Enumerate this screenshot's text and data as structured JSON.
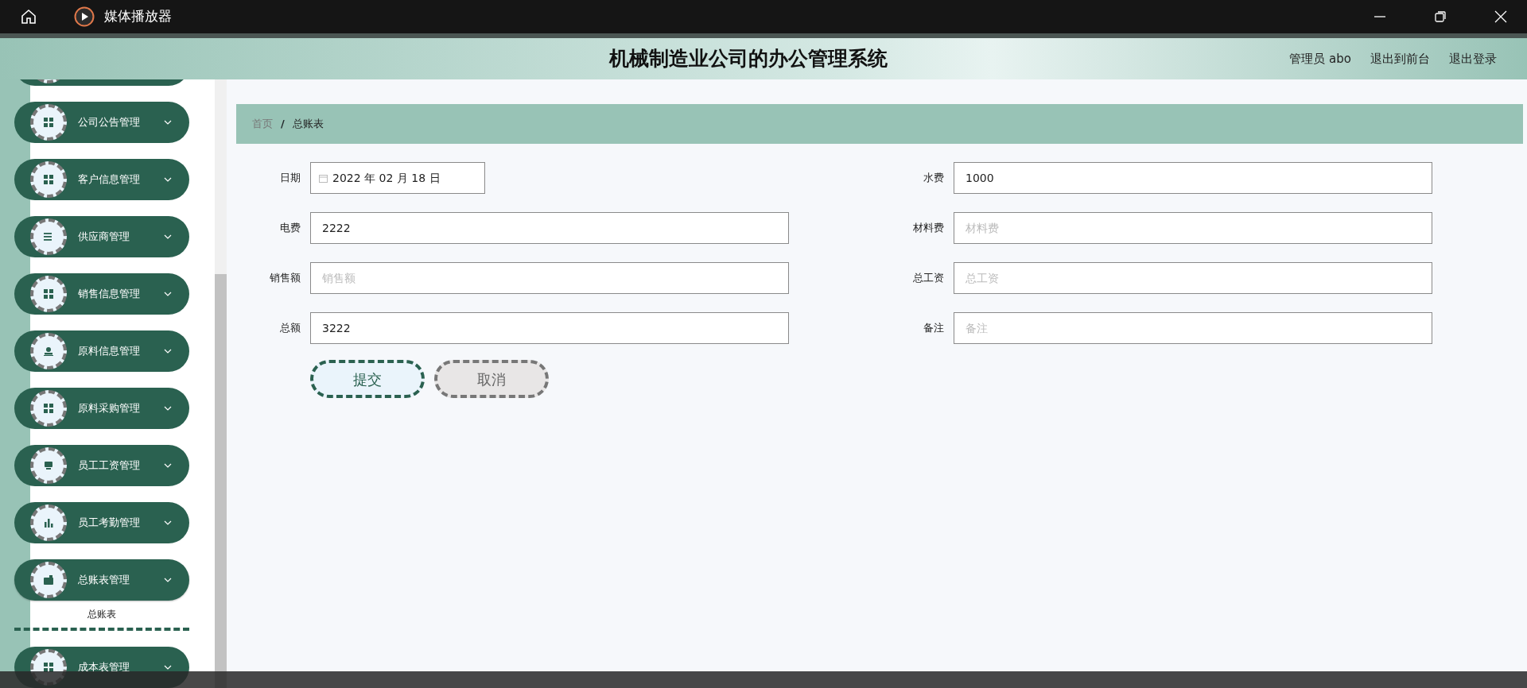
{
  "window": {
    "title": "媒体播放器"
  },
  "header": {
    "title": "机械制造业公司的办公管理系统",
    "links": [
      "管理员 abo",
      "退出到前台",
      "退出登录"
    ]
  },
  "sidebar": {
    "items": [
      {
        "label": "公司公告管理",
        "expanded": false
      },
      {
        "label": "客户信息管理",
        "expanded": false
      },
      {
        "label": "供应商管理",
        "expanded": false
      },
      {
        "label": "销售信息管理",
        "expanded": false
      },
      {
        "label": "原料信息管理",
        "expanded": false
      },
      {
        "label": "原料采购管理",
        "expanded": false
      },
      {
        "label": "员工工资管理",
        "expanded": false
      },
      {
        "label": "员工考勤管理",
        "expanded": false
      },
      {
        "label": "总账表管理",
        "expanded": true,
        "children": [
          {
            "label": "总账表"
          }
        ]
      },
      {
        "label": "成本表管理",
        "expanded": false
      }
    ]
  },
  "breadcrumb": {
    "items": [
      "首页",
      "总账表"
    ],
    "separator": "/"
  },
  "form": {
    "fields": [
      {
        "label": "日期",
        "kind": "date",
        "value": "2022 年 02 月 18 日"
      },
      {
        "label": "水费",
        "kind": "text",
        "value": "1000"
      },
      {
        "label": "电费",
        "kind": "text",
        "value": "2222"
      },
      {
        "label": "材料费",
        "kind": "text",
        "placeholder": "材料费"
      },
      {
        "label": "销售额",
        "kind": "text",
        "placeholder": "销售额"
      },
      {
        "label": "总工资",
        "kind": "text",
        "placeholder": "总工资"
      },
      {
        "label": "总额",
        "kind": "text",
        "value": "3222"
      },
      {
        "label": "备注",
        "kind": "text",
        "placeholder": "备注"
      }
    ],
    "buttons": [
      {
        "label": "提交",
        "kind": "primary"
      },
      {
        "label": "取消",
        "kind": "cancel"
      }
    ]
  }
}
